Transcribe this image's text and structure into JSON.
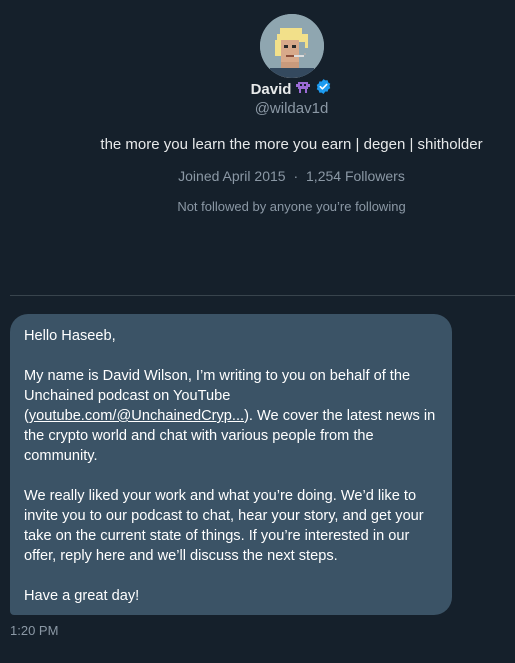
{
  "profile": {
    "display_name": "David",
    "handle": "@wildav1d",
    "bio": "the more you learn the more you earn | degen | shitholder",
    "joined": "Joined April 2015",
    "separator": "·",
    "followers": "1,254 Followers",
    "not_followed": "Not followed by anyone you’re following",
    "icons": [
      "avatar-pixel-art",
      "alien-monster-icon",
      "verified-badge-icon"
    ],
    "verified_color": "#1d9bf0",
    "emoji_color": "#9b6bd6"
  },
  "message": {
    "greeting": "Hello Haseeb,",
    "p1_before": "My name is David Wilson, I’m writing to you on behalf of the Unchained podcast on YouTube (",
    "p1_link": "youtube.com/@UnchainedCryp...",
    "p1_after": "). We cover the latest news in the crypto world and chat with various people from the community.",
    "p2": "We really liked your work and what you’re doing. We’d like to invite you to our podcast to chat, hear your story, and get your take on the current state of things. If you’re interested in our offer, reply here and we’ll discuss the next steps.",
    "closing": "Have a great day!",
    "timestamp": "1:20 PM",
    "bubble_color": "#3b5366"
  }
}
